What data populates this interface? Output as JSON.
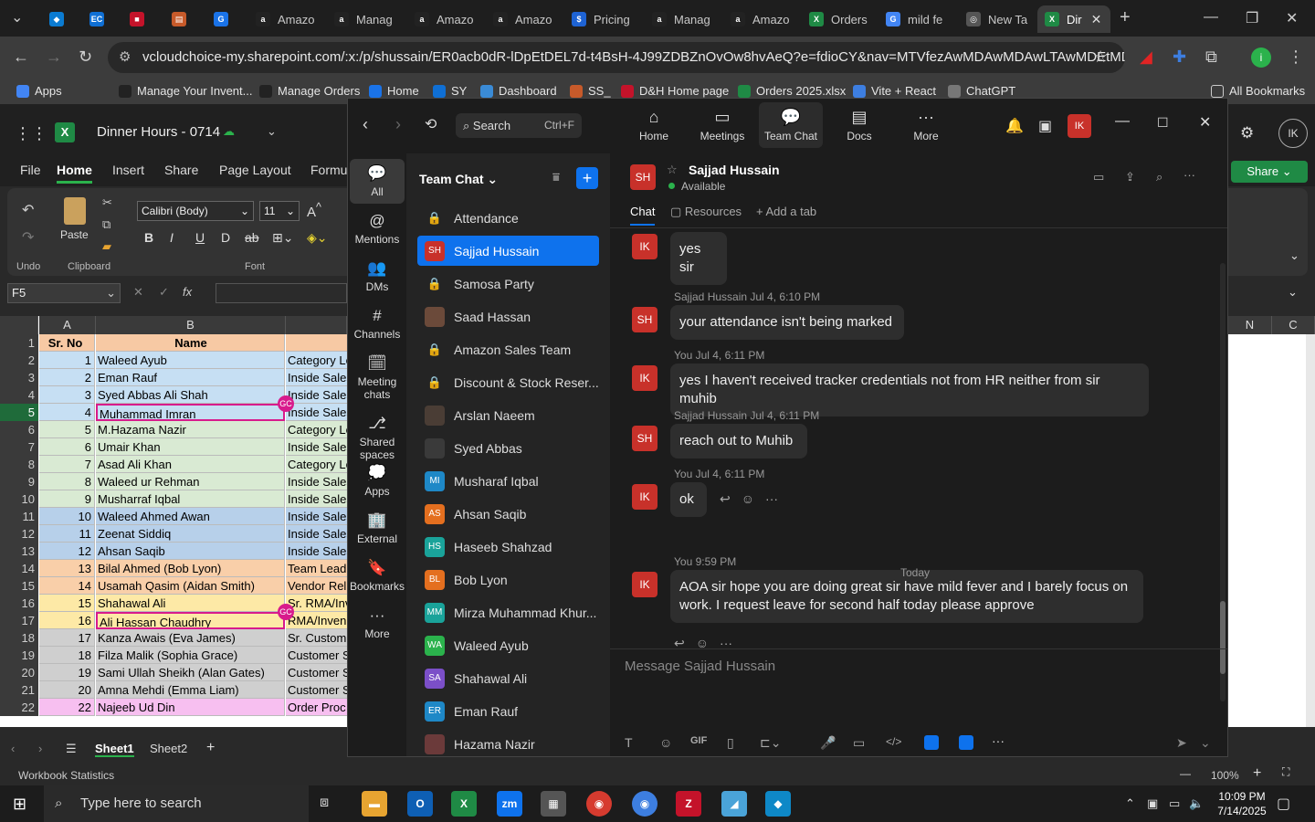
{
  "browser": {
    "tabs": [
      {
        "label": "",
        "color": "#0b7bd1",
        "glyph": "◆"
      },
      {
        "label": "",
        "color": "#0f6fd4",
        "glyph": "EC"
      },
      {
        "label": "",
        "color": "#c4132a",
        "glyph": "■"
      },
      {
        "label": "",
        "color": "#c75a2a",
        "glyph": "▤"
      },
      {
        "label": "",
        "color": "#1a73e8",
        "glyph": "G"
      },
      {
        "label": "Amazo",
        "color": "#222",
        "glyph": "a"
      },
      {
        "label": "Manag",
        "color": "#222",
        "glyph": "a"
      },
      {
        "label": "Amazo",
        "color": "#222",
        "glyph": "a"
      },
      {
        "label": "Amazo",
        "color": "#222",
        "glyph": "a"
      },
      {
        "label": "Pricing",
        "color": "#1e63d4",
        "glyph": "$"
      },
      {
        "label": "Manag",
        "color": "#222",
        "glyph": "a"
      },
      {
        "label": "Amazo",
        "color": "#222",
        "glyph": "a"
      },
      {
        "label": "Orders",
        "color": "#1f8a45",
        "glyph": "X"
      },
      {
        "label": "mild fe",
        "color": "#4285f4",
        "glyph": "G"
      },
      {
        "label": "New Ta",
        "color": "#555",
        "glyph": "◎"
      },
      {
        "label": "Dir",
        "color": "#1f8a45",
        "glyph": "X"
      }
    ],
    "url": "vcloudchoice-my.sharepoint.com/:x:/p/shussain/ER0acb0dR-lDpEtDEL7d-t4BsH-4J99ZDBZnOvOw8hvAeQ?e=fdioCY&nav=MTVfezAwMDAwMDAwLTAwMDEtMDAwMC...",
    "bookmarks": [
      {
        "label": "Apps",
        "color": "#4285f4"
      },
      {
        "label": "Manage Your Invent...",
        "color": "#222"
      },
      {
        "label": "Manage Orders",
        "color": "#222"
      },
      {
        "label": "Home",
        "color": "#1a73e8"
      },
      {
        "label": "SY",
        "color": "#0f6fd4"
      },
      {
        "label": "Dashboard",
        "color": "#3a8bd6"
      },
      {
        "label": "SS_",
        "color": "#c75a2a"
      },
      {
        "label": "D&H Home page",
        "color": "#c4132a"
      },
      {
        "label": "Orders 2025.xlsx",
        "color": "#1f8a45"
      },
      {
        "label": "Vite + React",
        "color": "#3d7ee0"
      },
      {
        "label": "ChatGPT",
        "color": "#777"
      }
    ],
    "all_bookmarks": "All Bookmarks"
  },
  "excel": {
    "doc_title": "Dinner Hours - 0714",
    "ribbon_tabs": [
      "File",
      "Home",
      "Insert",
      "Share",
      "Page Layout",
      "Formu"
    ],
    "font_name": "Calibri (Body)",
    "font_size": "11",
    "group_labels": {
      "undo": "Undo",
      "clipboard": "Clipboard",
      "font": "Font"
    },
    "paste": "Paste",
    "namebox": "F5",
    "share": "Share",
    "col_headers": [
      "A",
      "B"
    ],
    "right_col_headers": [
      "N",
      "C"
    ],
    "rows": [
      {
        "n": "1",
        "a": "Sr. No",
        "b": "Name",
        "c": "",
        "bg": "#f7c9a4"
      },
      {
        "n": "2",
        "a": "1",
        "b": "Waleed Ayub",
        "c": "Category Le",
        "bg": "#c6dff3"
      },
      {
        "n": "3",
        "a": "2",
        "b": "Eman Rauf",
        "c": "Inside Sales",
        "bg": "#c6dff3"
      },
      {
        "n": "4",
        "a": "3",
        "b": "Syed Abbas Ali Shah",
        "c": "Inside Sales",
        "bg": "#c6dff3"
      },
      {
        "n": "5",
        "a": "4",
        "b": "Muhammad Imran",
        "c": "Inside Sales",
        "bg": "#c6dff3"
      },
      {
        "n": "6",
        "a": "5",
        "b": "M.Hazama Nazir",
        "c": "Category Le",
        "bg": "#d9ead3"
      },
      {
        "n": "7",
        "a": "6",
        "b": "Umair Khan",
        "c": "Inside Sales",
        "bg": "#d9ead3"
      },
      {
        "n": "8",
        "a": "7",
        "b": "Asad Ali Khan",
        "c": "Category Le",
        "bg": "#d9ead3"
      },
      {
        "n": "9",
        "a": "8",
        "b": "Waleed ur Rehman",
        "c": "Inside Sales",
        "bg": "#d9ead3"
      },
      {
        "n": "10",
        "a": "9",
        "b": "Musharraf Iqbal",
        "c": "Inside Sales",
        "bg": "#d9ead3"
      },
      {
        "n": "11",
        "a": "10",
        "b": "Waleed Ahmed Awan",
        "c": "Inside Sales",
        "bg": "#b7d0ea"
      },
      {
        "n": "12",
        "a": "11",
        "b": "Zeenat Siddiq",
        "c": "Inside Sales",
        "bg": "#b7d0ea"
      },
      {
        "n": "13",
        "a": "12",
        "b": "Ahsan Saqib",
        "c": "Inside Sales",
        "bg": "#b7d0ea"
      },
      {
        "n": "14",
        "a": "13",
        "b": "Bilal Ahmed (Bob Lyon)",
        "c": "Team Lead",
        "bg": "#f9cfa9"
      },
      {
        "n": "15",
        "a": "14",
        "b": "Usamah Qasim (Aidan Smith)",
        "c": "Vendor Rel",
        "bg": "#f9cfa9"
      },
      {
        "n": "16",
        "a": "15",
        "b": "Shahawal Ali",
        "c": "Sr. RMA/Inv",
        "bg": "#fde9a6"
      },
      {
        "n": "17",
        "a": "16",
        "b": "Ali Hassan Chaudhry",
        "c": "RMA/Inven",
        "bg": "#fde9a6"
      },
      {
        "n": "18",
        "a": "17",
        "b": "Kanza Awais (Eva James)",
        "c": "Sr. Custom",
        "bg": "#cfcfcf"
      },
      {
        "n": "19",
        "a": "18",
        "b": "Filza Malik (Sophia Grace)",
        "c": "Customer S",
        "bg": "#cfcfcf"
      },
      {
        "n": "20",
        "a": "19",
        "b": "Sami Ullah Sheikh (Alan Gates)",
        "c": "Customer S",
        "bg": "#cfcfcf"
      },
      {
        "n": "21",
        "a": "20",
        "b": "Amna Mehdi (Emma Liam)",
        "c": "Customer S",
        "bg": "#cfcfcf"
      },
      {
        "n": "22",
        "a": "22",
        "b": "Najeeb Ud Din",
        "c": "Order Proc",
        "bg": "#f7bff0"
      }
    ],
    "sheets": [
      "Sheet1",
      "Sheet2"
    ],
    "status_left": "Workbook Statistics",
    "zoom": "100%"
  },
  "zoom": {
    "nav": [
      "Home",
      "Meetings",
      "Team Chat",
      "Docs",
      "More"
    ],
    "search": "Search",
    "search_shortcut": "Ctrl+F",
    "user_initials": "IK",
    "rail": [
      {
        "label": "All",
        "icon": "💬"
      },
      {
        "label": "Mentions",
        "icon": "@"
      },
      {
        "label": "DMs",
        "icon": "👥"
      },
      {
        "label": "Channels",
        "icon": "#"
      },
      {
        "label": "Meeting chats",
        "icon": "🗓"
      },
      {
        "label": "Shared spaces",
        "icon": "⎇"
      },
      {
        "label": "Apps",
        "icon": "💭"
      },
      {
        "label": "External",
        "icon": "🏢"
      },
      {
        "label": "Bookmarks",
        "icon": "🔖"
      },
      {
        "label": "More",
        "icon": "···"
      }
    ],
    "list_title": "Team Chat",
    "contacts": [
      {
        "name": "Attendance",
        "av": "🔒",
        "color": "",
        "lock": true,
        "dot": ""
      },
      {
        "name": "Sajjad Hussain",
        "av": "SH",
        "color": "#c8312a",
        "lock": false,
        "dot": ""
      },
      {
        "name": "Samosa Party",
        "av": "🔒",
        "color": "",
        "lock": true,
        "dot": ""
      },
      {
        "name": "Saad Hassan",
        "av": "",
        "color": "#6b4a3a",
        "lock": false,
        "dot": "green"
      },
      {
        "name": "Amazon Sales Team",
        "av": "🔒",
        "color": "",
        "lock": true,
        "dot": ""
      },
      {
        "name": "Discount & Stock Reser...",
        "av": "🔒",
        "color": "",
        "lock": true,
        "dot": ""
      },
      {
        "name": "Arslan Naeem",
        "av": "",
        "color": "#4a3d35",
        "lock": false,
        "dot": "grey"
      },
      {
        "name": "Syed Abbas",
        "av": "",
        "color": "#3a3a3a",
        "lock": false,
        "dot": ""
      },
      {
        "name": "Musharaf Iqbal",
        "av": "MI",
        "color": "#1e88c7",
        "lock": false,
        "dot": "green"
      },
      {
        "name": "Ahsan Saqib",
        "av": "AS",
        "color": "#e46f1f",
        "lock": false,
        "dot": "green"
      },
      {
        "name": "Haseeb Shahzad",
        "av": "HS",
        "color": "#1aa39a",
        "lock": false,
        "dot": "grey"
      },
      {
        "name": "Bob Lyon",
        "av": "BL",
        "color": "#e46f1f",
        "lock": false,
        "dot": "grey"
      },
      {
        "name": "Mirza Muhammad Khur...",
        "av": "MM",
        "color": "#1aa39a",
        "lock": false,
        "dot": "green"
      },
      {
        "name": "Waleed Ayub",
        "av": "WA",
        "color": "#2bb24c",
        "lock": false,
        "dot": "green"
      },
      {
        "name": "Shahawal Ali",
        "av": "SA",
        "color": "#7b4fc8",
        "lock": false,
        "dot": "grey"
      },
      {
        "name": "Eman Rauf",
        "av": "ER",
        "color": "#1e88c7",
        "lock": false,
        "dot": "grey"
      },
      {
        "name": "Hazama Nazir",
        "av": "",
        "color": "#6b3a3a",
        "lock": false,
        "dot": ""
      }
    ],
    "chat": {
      "name": "Sajjad Hussain",
      "initials": "SH",
      "status": "Available",
      "tabs": [
        "Chat",
        "Resources",
        "Add a tab"
      ],
      "messages": [
        {
          "who": "IK",
          "meta": "",
          "text": "yes sir"
        },
        {
          "who": "SH",
          "meta": "Sajjad Hussain Jul 4, 6:10 PM",
          "text": "your attendance isn't being marked"
        },
        {
          "who": "IK",
          "meta": "You Jul 4, 6:11 PM",
          "text": "yes I haven't received tracker credentials not from HR neither from sir muhib"
        },
        {
          "who": "SH",
          "meta": "Sajjad Hussain Jul 4, 6:11 PM",
          "text": "reach out to Muhib"
        },
        {
          "who": "IK",
          "meta": "You Jul 4, 6:11 PM",
          "text": "ok"
        },
        {
          "who": "IK",
          "meta": "You 9:59 PM",
          "text": "AOA sir hope you are doing great  sir have mild fever and I barely focus on work. I request leave for second half today  please approve"
        }
      ],
      "divider": "Today",
      "placeholder": "Message Sajjad Hussain"
    }
  },
  "taskbar": {
    "search": "Type here to search",
    "time": "10:09 PM",
    "date": "7/14/2025"
  }
}
